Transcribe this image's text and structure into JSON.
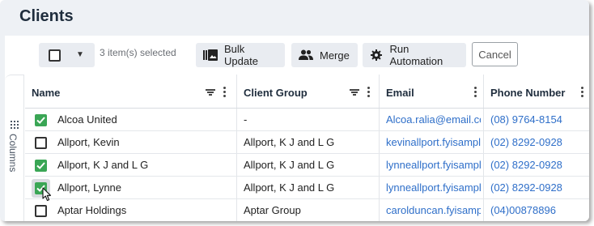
{
  "page": {
    "title": "Clients"
  },
  "toolbar": {
    "selected_count": "3 item(s) selected",
    "bulk_update_label": "Bulk Update",
    "merge_label": "Merge",
    "run_automation_label": "Run Automation",
    "cancel_label": "Cancel"
  },
  "sidebar": {
    "columns_label": "Columns"
  },
  "table": {
    "headers": {
      "name": "Name",
      "group": "Client Group",
      "email": "Email",
      "phone": "Phone Number"
    },
    "rows": [
      {
        "checked": true,
        "name": "Alcoa United",
        "group": "-",
        "email": "Alcoa.ralia@email.com",
        "phone": "(08) 9764-8154"
      },
      {
        "checked": false,
        "name": "Allport, Kevin",
        "group": "Allport, K J and L G",
        "email": "kevinallport.fyisample",
        "phone": "(02) 8292-0928"
      },
      {
        "checked": true,
        "name": "Allport, K J and L G",
        "group": "Allport, K J and L G",
        "email": "lynneallport.fyisample",
        "phone": "(02) 8292-0928"
      },
      {
        "checked": true,
        "name": "Allport, Lynne",
        "group": "Allport, K J and L G",
        "email": "lynneallport.fyisample",
        "phone": "(02) 8292-0928"
      },
      {
        "checked": false,
        "name": "Aptar Holdings",
        "group": "Aptar Group",
        "email": "carolduncan.fyisample",
        "phone": "(04)00878896"
      }
    ]
  },
  "colors": {
    "accent_green": "#3aa655",
    "link_blue": "#2f6fc9",
    "title": "#1f2d3d"
  }
}
